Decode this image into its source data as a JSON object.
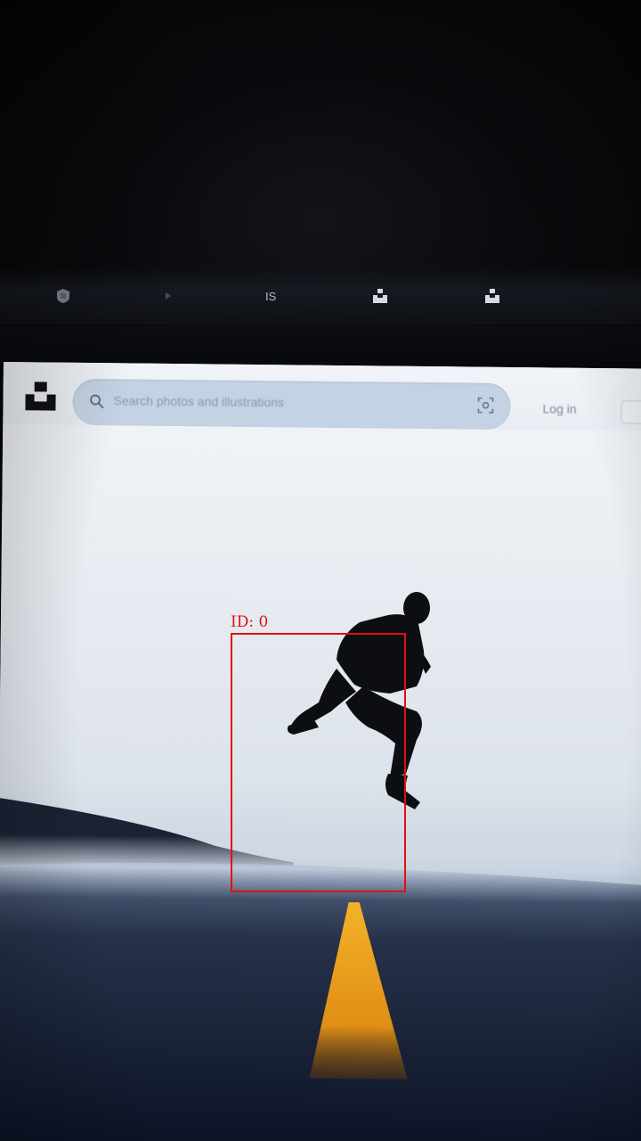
{
  "browser": {
    "tabs": [
      {
        "icon": "shield-icon",
        "label": ""
      },
      {
        "icon": "play-icon",
        "label": ""
      },
      {
        "icon": "is-icon",
        "label": ""
      },
      {
        "icon": "unsplash-icon",
        "label": ""
      },
      {
        "icon": "unsplash-icon",
        "label": ""
      }
    ],
    "url": ""
  },
  "header": {
    "logo": "unsplash-logo-icon",
    "search_placeholder": "Search photos and illustrations",
    "login_label": "Log in"
  },
  "colors": {
    "page_bg": "#eef2f6",
    "search_bg": "#c4d3e4",
    "road": "#10172a",
    "road_line": "#f0a81e",
    "detection": "#e01010"
  },
  "detection": {
    "label": "ID: 0"
  }
}
